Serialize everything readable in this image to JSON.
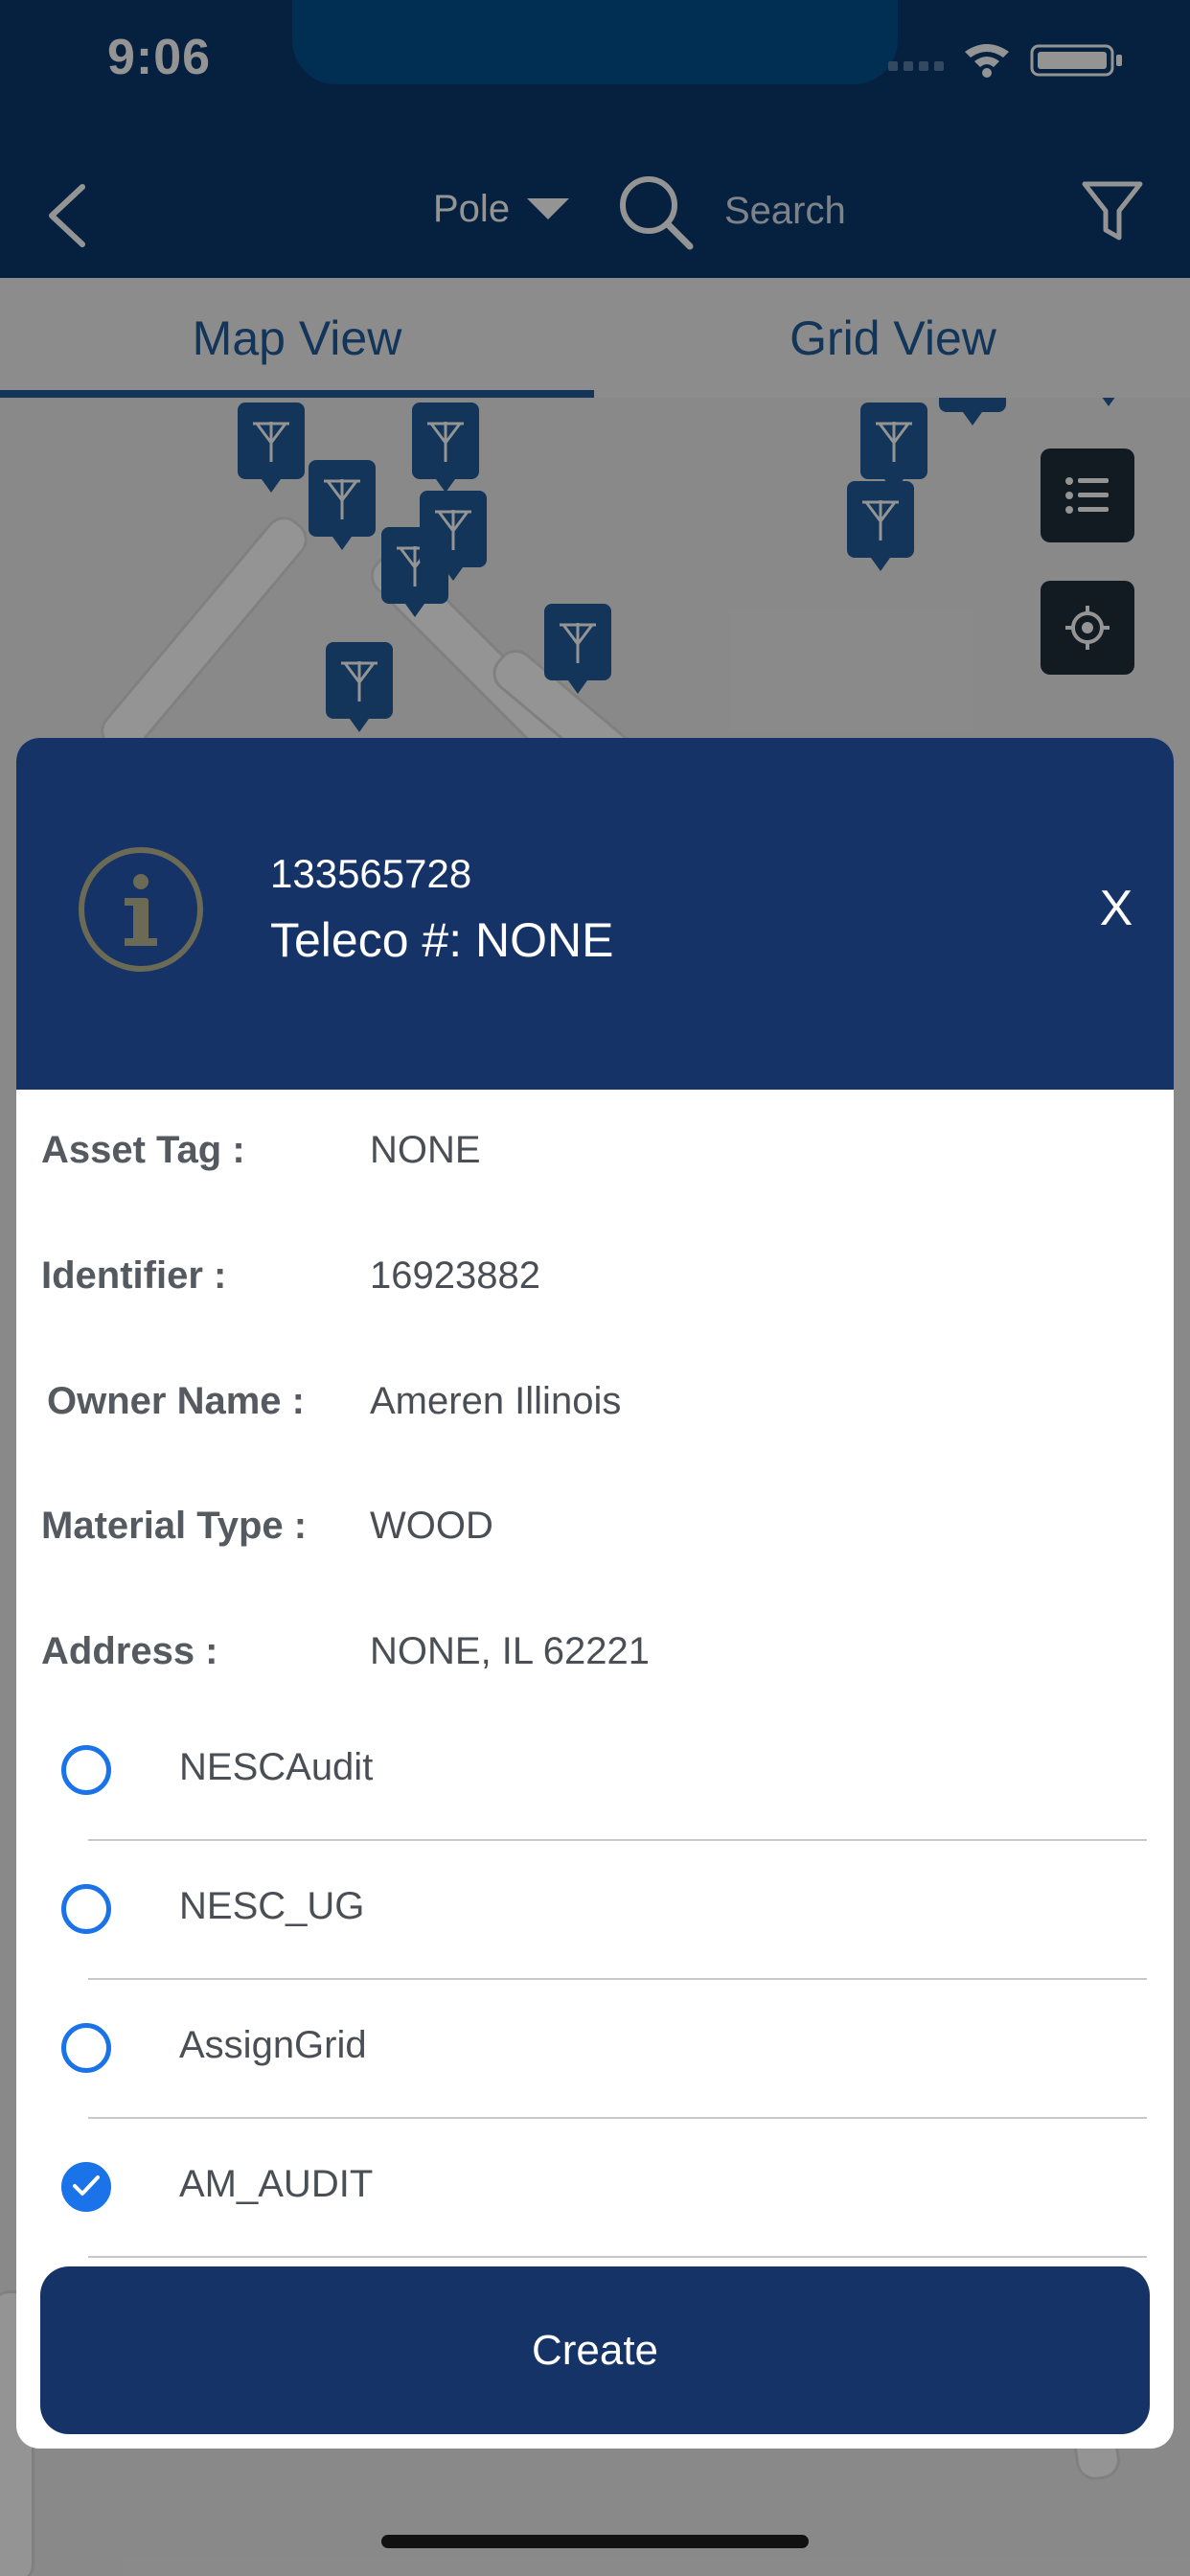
{
  "status_bar": {
    "time": "9:06"
  },
  "nav": {
    "selector_value": "Pole",
    "search_placeholder": "Search"
  },
  "tabs": [
    {
      "label": "Map View",
      "active": true
    },
    {
      "label": "Grid View",
      "active": false
    }
  ],
  "dialog": {
    "id": "133565728",
    "title": "Teleco #: NONE",
    "close_label": "X",
    "details": [
      {
        "label": "Asset Tag :",
        "value": "NONE"
      },
      {
        "label": "Identifier :",
        "value": "16923882"
      },
      {
        "label": "Owner Name :",
        "value": "Ameren Illinois"
      },
      {
        "label": "Material Type :",
        "value": "WOOD"
      },
      {
        "label": "Address :",
        "value": "NONE, IL 62221"
      }
    ],
    "options": [
      {
        "label": "NESCAudit",
        "checked": false
      },
      {
        "label": "NESC_UG",
        "checked": false
      },
      {
        "label": "AssignGrid",
        "checked": false
      },
      {
        "label": "AM_AUDIT",
        "checked": true
      }
    ],
    "create_label": "Create"
  },
  "colors": {
    "header": "#0b3a6e",
    "dialog_header": "#163367",
    "accent": "#1a73e8",
    "marker": "#1f5c99"
  }
}
